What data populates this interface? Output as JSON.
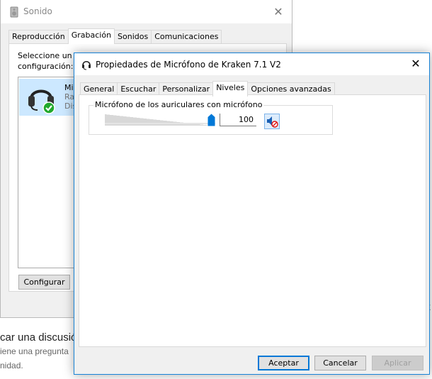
{
  "background_page": {
    "heading": "car una discusió",
    "line1": "iene una pregunta",
    "line2": "nidad.",
    "tick1": "X",
    "tick2": "X"
  },
  "sonido_dialog": {
    "title": "Sonido",
    "tabs": [
      "Reproducción",
      "Grabación",
      "Sonidos",
      "Comunicaciones"
    ],
    "active_tab": "Grabación",
    "instruction_line1": "Seleccione un d",
    "instruction_line2": "configuración:",
    "device": {
      "name": "Mi",
      "line2": "Ra",
      "line3": "Dis"
    },
    "configure_button": "Configurar"
  },
  "props_dialog": {
    "title": "Propiedades de Micrófono de Kraken 7.1 V2",
    "tabs": [
      "General",
      "Escuchar",
      "Personalizar",
      "Niveles",
      "Opciones avanzadas"
    ],
    "active_tab": "Niveles",
    "group_label": "Micrófono de los auriculares con micrófono",
    "level": 100,
    "level_text": "100",
    "muted": true,
    "ok_button": "Aceptar",
    "cancel_button": "Cancelar",
    "apply_button": "Aplicar",
    "accent_color": "#0078d7"
  }
}
